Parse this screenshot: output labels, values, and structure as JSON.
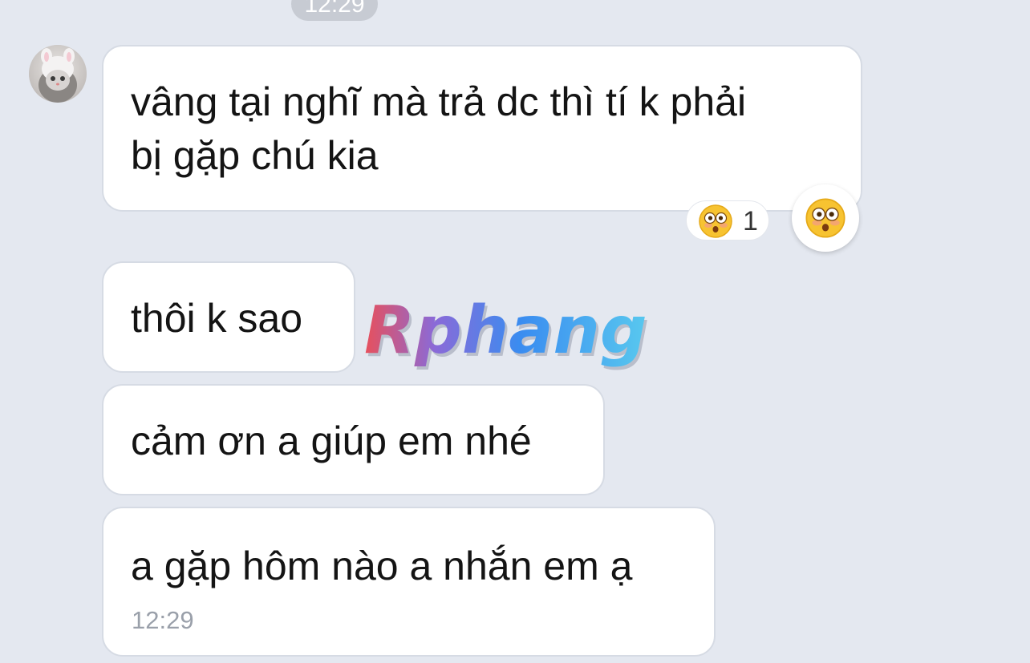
{
  "header": {
    "timestamp": "12:29"
  },
  "messages": [
    {
      "text_lines": [
        "vâng tại nghĩ mà trả dc thì tí k phải",
        "bị gặp chú kia"
      ],
      "time": ""
    },
    {
      "text_lines": [
        "thôi k sao"
      ],
      "time": ""
    },
    {
      "text_lines": [
        "cảm ơn a giúp em nhé"
      ],
      "time": ""
    },
    {
      "text_lines": [
        "a gặp hôm nào a nhắn em ạ"
      ],
      "time": "12:29"
    }
  ],
  "reaction": {
    "emoji_icon": "flushed-face-emoji",
    "count": "1"
  },
  "react_button": {
    "emoji_icon": "flushed-face-emoji"
  },
  "watermark": {
    "text": "Rphang"
  },
  "colors": {
    "background": "#e4e8f0",
    "bubble": "#ffffff",
    "time_pill": "#c7cbd3",
    "timestamp_text": "#9aa0aa",
    "emoji_yellow": "#f7c331"
  }
}
